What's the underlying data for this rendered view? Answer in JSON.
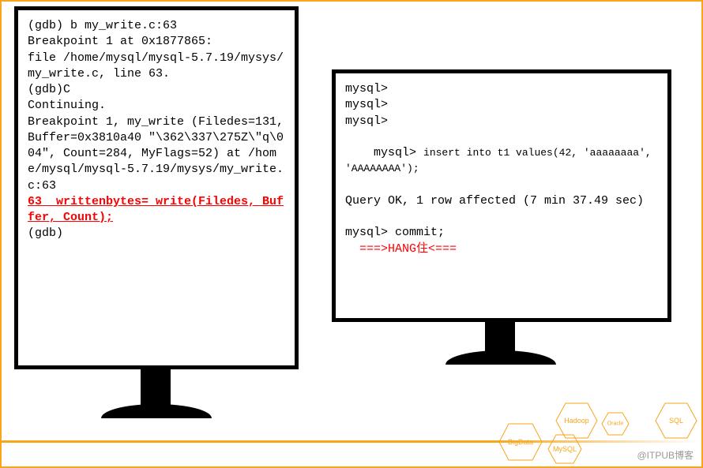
{
  "left_terminal": {
    "l1": "(gdb) b my_write.c:63",
    "l2": "Breakpoint 1 at 0x1877865:",
    "l3": "file /home/mysql/mysql-5.7.19/mysys/my_write.c, line 63.",
    "l4": "(gdb)C",
    "l5": "Continuing.",
    "l6": "Breakpoint 1, my_write (Filedes=131, Buffer=0x3810a40 \"\\362\\337\\275Z\\\"q\\004\", Count=284, MyFlags=52) at /home/mysql/mysql-5.7.19/mysys/my_write.c:63",
    "l7": "63  writtenbytes= write(Filedes, Buffer, Count);",
    "l8": "(gdb)"
  },
  "right_terminal": {
    "p1": "mysql>",
    "p2": "mysql>",
    "p3": "mysql>",
    "p4_prefix": "mysql> ",
    "p4_cmd": "insert into t1 values(42, 'aaaaaaaa', 'AAAAAAAA');",
    "p5": "Query OK, 1 row affected (7 min 37.49 sec)",
    "blank": " ",
    "p6": "mysql> commit;",
    "p7": "  ===>HANG住<==="
  },
  "footer": {
    "hex1": "BigData",
    "hex2": "Hadoop",
    "hex3": "MySQL",
    "hex4": "Oracle",
    "hex5": "SQL",
    "watermark": "@ITPUB博客"
  }
}
